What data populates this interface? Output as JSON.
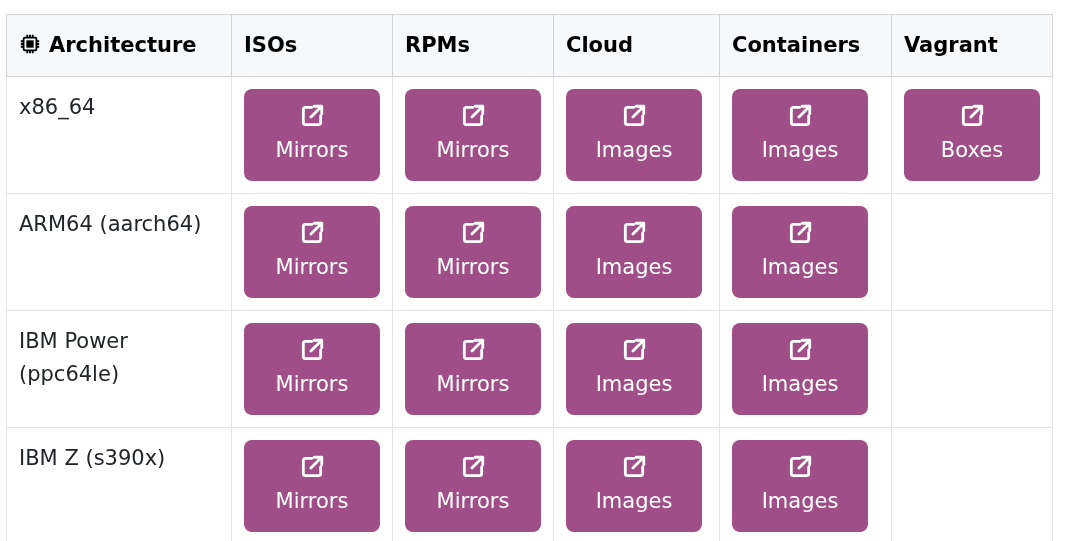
{
  "table": {
    "columns": [
      "Architecture",
      "ISOs",
      "RPMs",
      "Cloud",
      "Containers",
      "Vagrant"
    ],
    "rows": [
      {
        "architecture": "x86_64",
        "links": [
          "Mirrors",
          "Mirrors",
          "Images",
          "Images",
          "Boxes"
        ]
      },
      {
        "architecture": "ARM64 (aarch64)",
        "links": [
          "Mirrors",
          "Mirrors",
          "Images",
          "Images"
        ]
      },
      {
        "architecture": "IBM Power (ppc64le)",
        "links": [
          "Mirrors",
          "Mirrors",
          "Images",
          "Images"
        ]
      },
      {
        "architecture": "IBM Z (s390x)",
        "links": [
          "Mirrors",
          "Mirrors",
          "Images",
          "Images"
        ]
      }
    ]
  }
}
